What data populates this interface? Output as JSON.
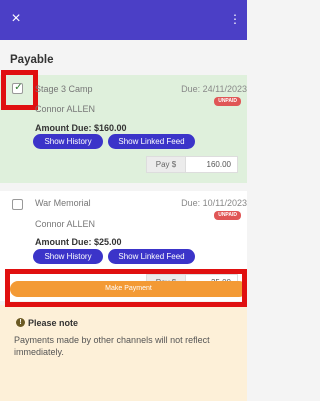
{
  "topbar": {
    "close_icon": "close-icon",
    "menu_icon": "more-vertical-icon",
    "close_glyph": "×",
    "menu_glyph": "⋮"
  },
  "section": {
    "title": "Payable"
  },
  "items": [
    {
      "title": "Stage 3 Camp",
      "due": "Due: 24/11/2023",
      "status": "UNPAID",
      "person": "Connor ALLEN",
      "amount": "Amount Due: $160.00",
      "history_label": "Show History",
      "feed_label": "Show Linked Feed",
      "pay_label": "Pay $",
      "pay_value": "160.00",
      "checked": true
    },
    {
      "title": "War Memorial",
      "due": "Due: 10/11/2023",
      "status": "UNPAID",
      "person": "Connor ALLEN",
      "amount": "Amount Due: $25.00",
      "history_label": "Show History",
      "feed_label": "Show Linked Feed",
      "pay_label": "Pay $",
      "pay_value": "25.00",
      "checked": false
    }
  ],
  "make_payment": {
    "label": "Make Payment"
  },
  "note": {
    "title": "Please note",
    "icon_glyph": "!",
    "text": "Payments made by other channels will not reflect immediately."
  },
  "colors": {
    "topbar": "#4b3fc6",
    "button": "#3b34c9",
    "selected_card": "#dff0dc",
    "make_payment": "#f39a35",
    "note_bg": "#fdf0d8",
    "unpaid_badge": "#e05656",
    "highlight": "#e01010"
  }
}
